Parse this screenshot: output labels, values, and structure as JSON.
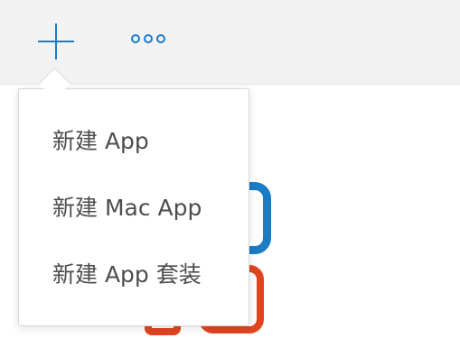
{
  "toolbar": {
    "add_icon": "plus-icon",
    "more_icon": "more-options-icon",
    "accent_color": "#1a7cc7"
  },
  "menu": {
    "items": [
      {
        "label": "新建 App"
      },
      {
        "label": "新建 Mac App"
      },
      {
        "label": "新建 App 套装"
      }
    ]
  },
  "background_icons": {
    "blue": "#1a7cc7",
    "red": "#e1451f"
  }
}
